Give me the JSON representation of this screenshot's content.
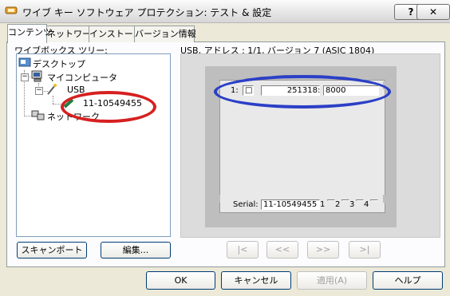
{
  "window": {
    "title": "ワイブ キー ソフトウェア プロテクション: テスト & 設定",
    "help_button": "?",
    "close_button": "✕"
  },
  "tabs": [
    {
      "label": "コンテンツ"
    },
    {
      "label": "ネットワーク"
    },
    {
      "label": "インストール"
    },
    {
      "label": "バージョン情報"
    }
  ],
  "tree": {
    "label": "ワイブボックス ツリー:",
    "items": {
      "desktop": "デスクトップ",
      "my_computer": "マイコンピュータ",
      "usb": "USB",
      "key": "11-10549455",
      "network": "ネットワーク"
    }
  },
  "detail": {
    "header": "USB, アドレス : 1/1, バージョン 7 (ASIC 1804)",
    "row1": {
      "index": "1:",
      "marker": "□",
      "value1": "251318",
      "sep": ":",
      "value2": "8000"
    },
    "serial": {
      "label": "Serial:",
      "value": "11-10549455",
      "slots": [
        "1",
        "2",
        "3",
        "4"
      ]
    }
  },
  "buttons": {
    "scan_port": "スキャンポート",
    "edit": "編集...",
    "nav_first": "|<",
    "nav_prev": "<<",
    "nav_next": ">>",
    "nav_last": ">|",
    "ok": "OK",
    "cancel": "キャンセル",
    "apply": "適用(A)",
    "help": "ヘルプ"
  },
  "annotation_colors": {
    "red_circle": "#d62020",
    "blue_circle": "#2b3fc6"
  }
}
